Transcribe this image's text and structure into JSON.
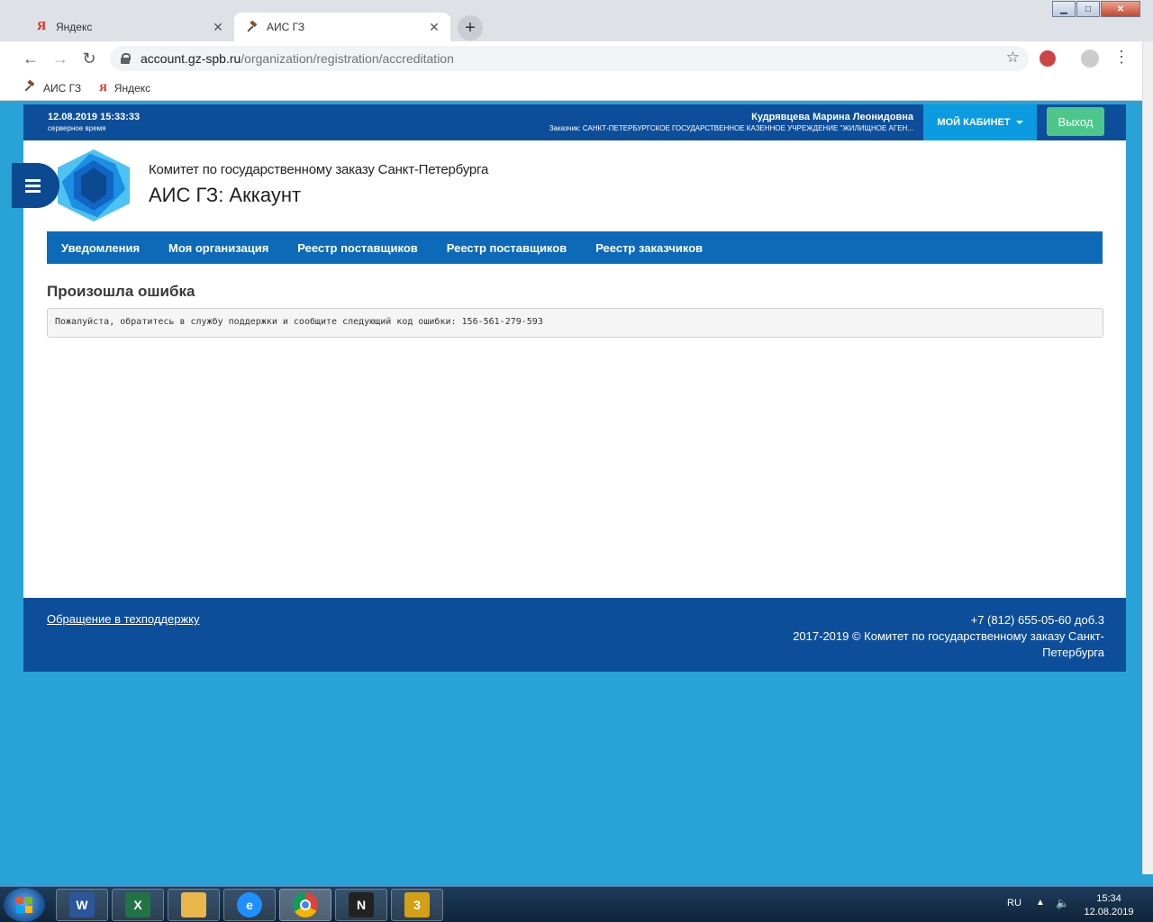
{
  "browser": {
    "tabs": [
      {
        "title": "Яндекс",
        "favicon": "yandex-icon",
        "active": false
      },
      {
        "title": "АИС ГЗ",
        "favicon": "gavel-icon",
        "active": true
      }
    ],
    "new_tab_label": "+",
    "url_host": "account.gz-spb.ru",
    "url_path": "/organization/registration/accreditation",
    "bookmarks": [
      {
        "label": "АИС ГЗ",
        "icon": "gavel-icon"
      },
      {
        "label": "Яндекс",
        "icon": "yandex-icon"
      }
    ]
  },
  "header": {
    "server_time": "12.08.2019 15:33:33",
    "server_time_label": "серверное время",
    "user_name": "Кудрявцева Марина Леонидовна",
    "user_org": "Заказчик: САНКТ-ПЕТЕРБУРГСКОЕ ГОСУДАРСТВЕННОЕ КАЗЕННОЕ УЧРЕЖДЕНИЕ \"ЖИЛИЩНОЕ АГЕН...",
    "cabinet_label": "МОЙ КАБИНЕТ",
    "exit_label": "Выход"
  },
  "brand": {
    "org_title": "Комитет по государственному заказу Санкт-Петербурга",
    "app_title": "АИС ГЗ: Аккаунт",
    "logo_color": "#1a8fe3"
  },
  "nav": [
    {
      "label": "Уведомления"
    },
    {
      "label": "Моя организация"
    },
    {
      "label": "Реестр поставщиков"
    },
    {
      "label": "Реестр поставщиков"
    },
    {
      "label": "Реестр заказчиков"
    }
  ],
  "error": {
    "title": "Произошла ошибка",
    "message": "Пожалуйста, обратитесь в службу поддержки и сообщите следующий код ошибки: 156-561-279-593"
  },
  "footer": {
    "support_link": "Обращение в техподдержку",
    "phone": "+7 (812) 655-05-60 доб.3",
    "copyright": "2017-2019 © Комитет по государственному заказу Санкт-Петербурга"
  },
  "taskbar": {
    "apps": [
      {
        "name": "word-icon",
        "letter": "W",
        "color": "#2b579a"
      },
      {
        "name": "excel-icon",
        "letter": "X",
        "color": "#217346"
      },
      {
        "name": "explorer-icon",
        "letter": "",
        "color": "#e8b64a"
      },
      {
        "name": "ie-icon",
        "letter": "e",
        "color": "#1e90ff"
      },
      {
        "name": "chrome-icon",
        "letter": "",
        "color": "#db4437"
      },
      {
        "name": "nfs-icon",
        "letter": "N",
        "color": "#222222"
      },
      {
        "name": "media-icon",
        "letter": "3",
        "color": "#d4a017"
      }
    ],
    "lang": "RU",
    "time": "15:34",
    "date": "12.08.2019"
  },
  "colors": {
    "header_bg": "#0d4e9b",
    "nav_bg": "#0d6ab8",
    "cabinet_bg": "#0a9be0",
    "exit_bg": "#4cc789",
    "desktop_bg": "#29a3d7"
  }
}
